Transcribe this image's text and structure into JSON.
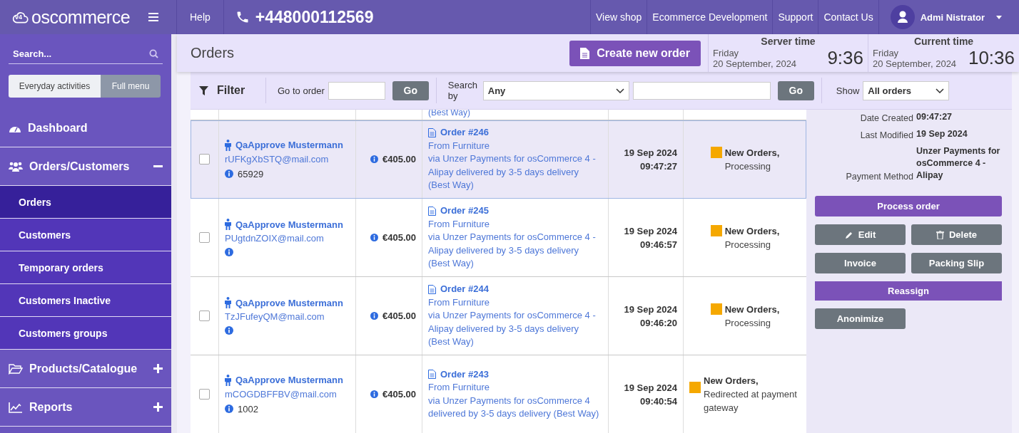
{
  "header": {
    "logo_badge": "v4",
    "logo_text": "oscommerce",
    "help": "Help",
    "phone": "+448000112569",
    "links": [
      "View shop",
      "Ecommerce Development",
      "Support",
      "Contact Us"
    ],
    "user": "Admi Nistrator"
  },
  "sidebar": {
    "search_placeholder": "Search...",
    "modes": [
      {
        "label": "Everyday activities",
        "selected": false
      },
      {
        "label": "Full menu",
        "selected": true
      }
    ],
    "items": [
      {
        "label": "Dashboard",
        "kind": "dashboard"
      },
      {
        "label": "Orders/Customers",
        "kind": "users",
        "expanded": true,
        "children": [
          {
            "label": "Orders",
            "selected": true
          },
          {
            "label": "Customers",
            "selected": false
          },
          {
            "label": "Temporary orders",
            "selected": false
          },
          {
            "label": "Customers Inactive",
            "selected": false
          },
          {
            "label": "Customers groups",
            "selected": false
          }
        ]
      },
      {
        "label": "Products/Catalogue",
        "kind": "folder",
        "expanded": false
      },
      {
        "label": "Reports",
        "kind": "chart",
        "expanded": false
      }
    ]
  },
  "page": {
    "title": "Orders",
    "create_button": "Create new order",
    "clocks": [
      {
        "label": "Server time",
        "day": "Friday",
        "date": "20 September, 2024",
        "time": "9:36"
      },
      {
        "label": "Current time",
        "day": "Friday",
        "date": "20 September, 2024",
        "time": "10:36"
      }
    ]
  },
  "filter": {
    "title": "Filter",
    "goto_label": "Go to order",
    "go": "Go",
    "search_label": "Search by",
    "search_by": "Any",
    "go2": "Go",
    "show_label": "Show",
    "show_value": "All orders"
  },
  "table": {
    "partial_row_text": "(Best Way)",
    "rows": [
      {
        "selected": true,
        "checked": false,
        "customer": "QaApprove Mustermann",
        "email": "rUFKgXbSTQ@mail.com",
        "customer_note": "65929",
        "amount": "€405.00",
        "order": "Order #246",
        "from": "From Furniture",
        "via": "via Unzer Payments for osCommerce 4 - Alipay delivered by 3-5 days delivery (Best Way)",
        "date": "19 Sep 2024",
        "time": "09:47:27",
        "status": "New Orders,",
        "substatus": "Processing",
        "color": "#f5a800"
      },
      {
        "selected": false,
        "checked": false,
        "customer": "QaApprove Mustermann",
        "email": "PUgtdnZOIX@mail.com",
        "customer_note": "",
        "amount": "€405.00",
        "order": "Order #245",
        "from": "From Furniture",
        "via": "via Unzer Payments for osCommerce 4 - Alipay delivered by 3-5 days delivery (Best Way)",
        "date": "19 Sep 2024",
        "time": "09:46:57",
        "status": "New Orders,",
        "substatus": "Processing",
        "color": "#f5a800"
      },
      {
        "selected": false,
        "checked": false,
        "customer": "QaApprove Mustermann",
        "email": "TzJFufeyQM@mail.com",
        "customer_note": "",
        "amount": "€405.00",
        "order": "Order #244",
        "from": "From Furniture",
        "via": "via Unzer Payments for osCommerce 4 - Alipay delivered by 3-5 days delivery (Best Way)",
        "date": "19 Sep 2024",
        "time": "09:46:20",
        "status": "New Orders,",
        "substatus": "Processing",
        "color": "#f5a800"
      },
      {
        "selected": false,
        "checked": false,
        "customer": "QaApprove Mustermann",
        "email": "mCOGDBFFBV@mail.com",
        "customer_note": "1002",
        "amount": "€405.00",
        "order": "Order #243",
        "from": "From Furniture",
        "via": "via Unzer Payments for osCommerce 4 delivered by 3-5 days delivery (Best Way)",
        "date": "19 Sep 2024",
        "time": "09:40:54",
        "status": "New Orders,",
        "substatus": "Redirected at payment gateway",
        "color": "#f5a800"
      }
    ]
  },
  "details": {
    "fields": [
      {
        "label": "Date Created",
        "value": "09:47:27"
      },
      {
        "label": "Last Modified",
        "value": "19 Sep 2024"
      },
      {
        "label": "Payment Method",
        "value": "Unzer Payments for osCommerce 4 - Alipay"
      }
    ],
    "buttons": [
      {
        "label": "Process order",
        "kind": "primary"
      },
      {
        "label": "Edit",
        "kind": "edit"
      },
      {
        "label": "Delete",
        "kind": "delete"
      },
      {
        "label": "Invoice",
        "kind": "plain"
      },
      {
        "label": "Packing Slip",
        "kind": "plain"
      },
      {
        "label": "Reassign",
        "kind": "band"
      },
      {
        "label": "Anonimize",
        "kind": "plain"
      }
    ]
  }
}
